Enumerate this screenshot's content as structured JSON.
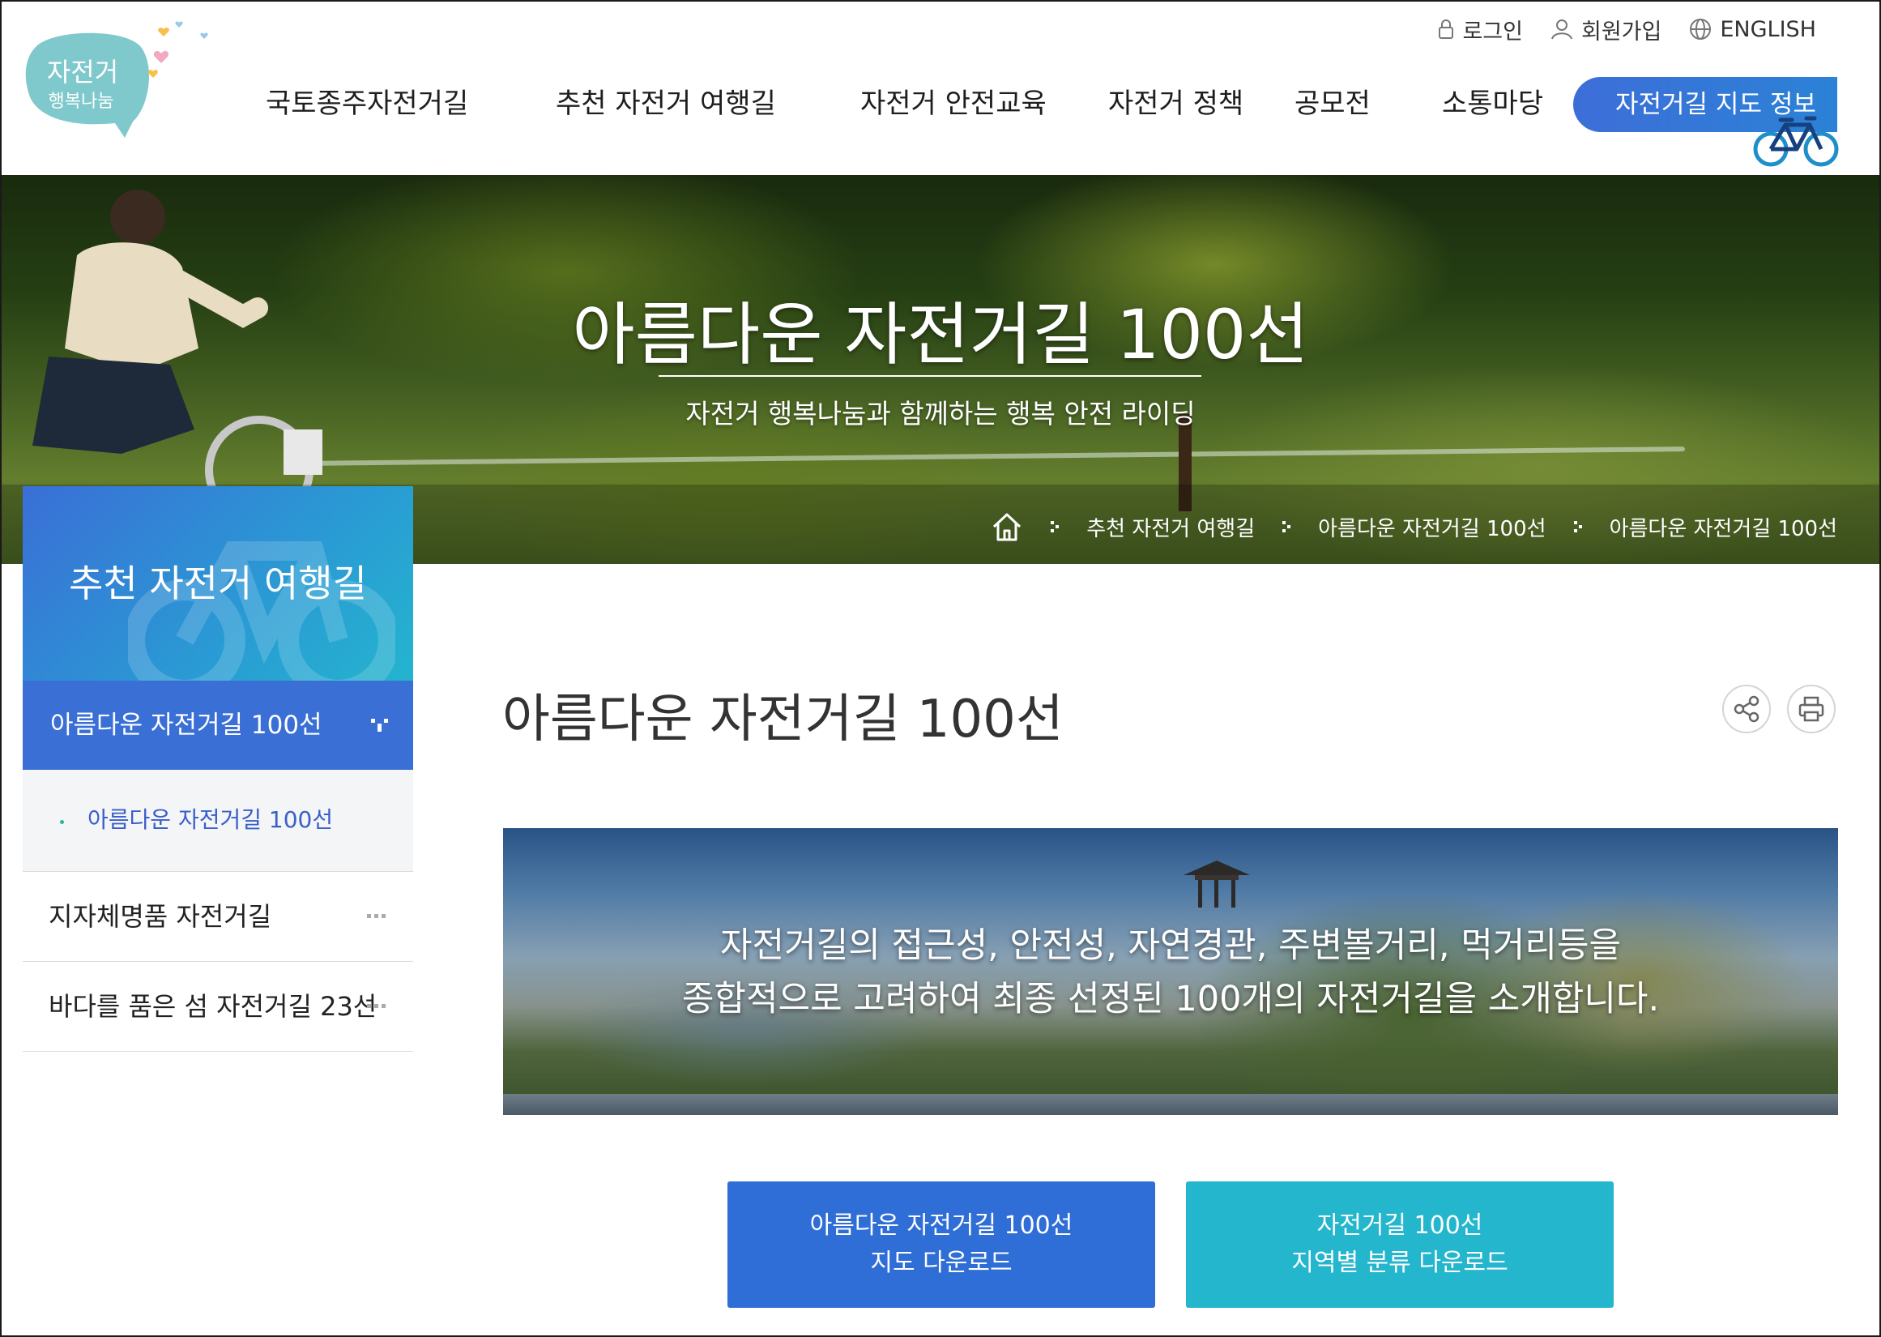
{
  "logo": {
    "line1": "자전거",
    "line2": "행복나눔"
  },
  "util_links": [
    {
      "label": "로그인",
      "icon": "lock-icon"
    },
    {
      "label": "회원가입",
      "icon": "person-icon"
    },
    {
      "label": "ENGLISH",
      "icon": "globe-icon"
    }
  ],
  "gnb": {
    "items": [
      "국토종주자전거길",
      "추천 자전거 여행길",
      "자전거 안전교육",
      "자전거 정책",
      "공모전",
      "소통마당"
    ],
    "map_button": "자전거길 지도 정보"
  },
  "hero": {
    "title": "아름다운 자전거길 100선",
    "subtitle": "자전거 행복나눔과 함께하는 행복 안전 라이딩"
  },
  "breadcrumb": [
    "추천 자전거 여행길",
    "아름다운 자전거길 100선",
    "아름다운 자전거길 100선"
  ],
  "sidebar": {
    "title": "추천 자전거 여행길",
    "active": "아름다운 자전거길 100선",
    "sub_items": [
      "아름다운 자전거길 100선"
    ],
    "items": [
      "지자체명품 자전거길",
      "바다를 품은 섬 자전거길 23선"
    ]
  },
  "content": {
    "title": "아름다운 자전거길 100선",
    "banner_line1": "자전거길의 접근성, 안전성, 자연경관, 주변볼거리, 먹거리등을",
    "banner_line2": "종합적으로 고려하여 최종 선정된 100개의 자전거길을 소개합니다.",
    "button1_line1": "아름다운 자전거길 100선",
    "button1_line2": "지도 다운로드",
    "button2_line1": "자전거길 100선",
    "button2_line2": "지역별 분류 다운로드"
  },
  "colors": {
    "primary_blue": "#3a6fd6",
    "teal": "#24b6cc",
    "sub_link": "#3a5fc8"
  }
}
